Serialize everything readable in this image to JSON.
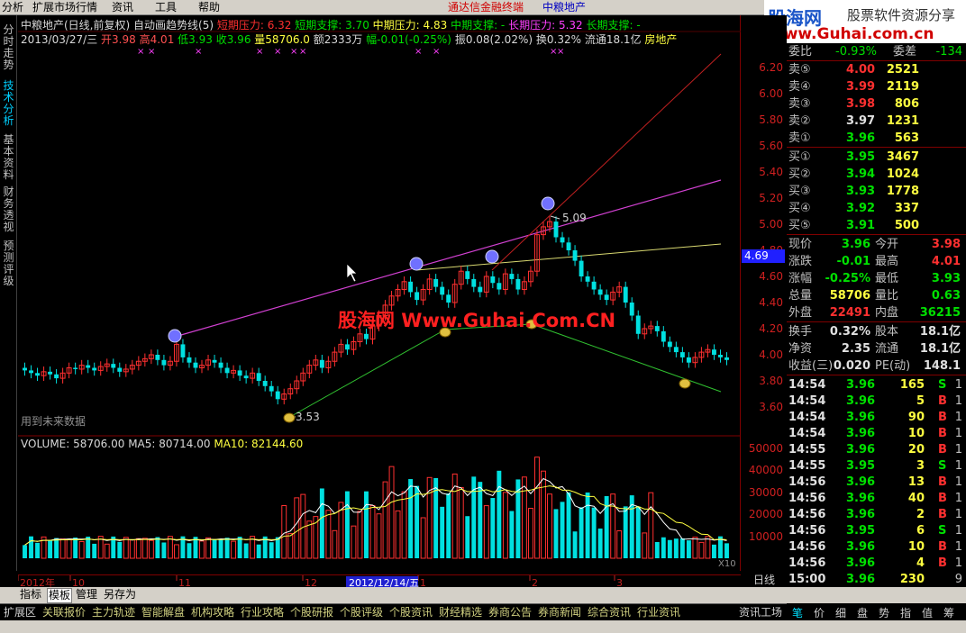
{
  "menubar": {
    "items": [
      "分析",
      "扩展市场行情",
      "资讯",
      "工具",
      "帮助"
    ],
    "center_red": "通达信金融终端",
    "center_blue": "中粮地产"
  },
  "logo": {
    "brand": "股海网",
    "tagline": "股票软件资源分享",
    "url": "www.Guhai.com.cn"
  },
  "sidetabs": [
    {
      "label": "分时走势",
      "active": false
    },
    {
      "label": "技术分析",
      "active": true
    },
    {
      "label": "基本资料",
      "active": false
    },
    {
      "label": "财务透视",
      "active": false
    },
    {
      "label": "预测评级",
      "active": false
    }
  ],
  "header": {
    "title": "中粮地产(日线,前复权)",
    "indicator": "自动画趋势线(5)",
    "short_pressure": "短期压力: 6.32",
    "short_support": "短期支撑: 3.70",
    "mid_pressure": "中期压力: 4.83",
    "mid_support": "中期支撑: -",
    "long_pressure": "长期压力: 5.32",
    "long_support": "长期支撑: -",
    "date": "2013/03/27/三",
    "open": "开3.98",
    "high": "高4.01",
    "low": "低3.93",
    "close": "收3.96",
    "volume": "量58706.0",
    "amount": "额2333万",
    "change": "幅-0.01(-0.25%)",
    "amplitude": "振0.08(2.02%)",
    "turnover": "换0.32%",
    "float": "流通18.1亿",
    "sector": "房地产"
  },
  "annotations": {
    "peak": "5.09",
    "trough": "3.53",
    "future_data": "用到未来数据",
    "watermark": "股海网 Www.Guhai.Com.CN"
  },
  "volume_header": {
    "volume": "VOLUME: 58706.00",
    "ma5": "MA5: 80714.00",
    "ma10": "MA10: 82144.60"
  },
  "price_axis": [
    "6.20",
    "6.00",
    "5.80",
    "5.60",
    "5.40",
    "5.20",
    "5.00",
    "4.80",
    "4.60",
    "4.40",
    "4.20",
    "4.00",
    "3.80",
    "3.60"
  ],
  "volume_axis": [
    "50000",
    "40000",
    "30000",
    "20000",
    "10000"
  ],
  "volume_unit": "X10",
  "current_price_tag": "4.69",
  "date_axis": {
    "labels": [
      "2012年",
      "10",
      "11",
      "12",
      "1",
      "2",
      "3"
    ],
    "cursor_date": "2012/12/14/五"
  },
  "quote": {
    "weibi_label": "委比",
    "weibi_value": "-0.93%",
    "weicha_label": "委差",
    "weicha_value": "-134",
    "asks": [
      {
        "label": "卖⑤",
        "price": "4.00",
        "vol": "2521",
        "color": "#ff3030"
      },
      {
        "label": "卖④",
        "price": "3.99",
        "vol": "2119",
        "color": "#ff3030"
      },
      {
        "label": "卖③",
        "price": "3.98",
        "vol": "806",
        "color": "#ff3030"
      },
      {
        "label": "卖②",
        "price": "3.97",
        "vol": "1231",
        "color": "#e0e0e0"
      },
      {
        "label": "卖①",
        "price": "3.96",
        "vol": "563",
        "color": "#00e000"
      }
    ],
    "bids": [
      {
        "label": "买①",
        "price": "3.95",
        "vol": "3467",
        "color": "#00e000"
      },
      {
        "label": "买②",
        "price": "3.94",
        "vol": "1024",
        "color": "#00e000"
      },
      {
        "label": "买③",
        "price": "3.93",
        "vol": "1778",
        "color": "#00e000"
      },
      {
        "label": "买④",
        "price": "3.92",
        "vol": "337",
        "color": "#00e000"
      },
      {
        "label": "买⑤",
        "price": "3.91",
        "vol": "500",
        "color": "#00e000"
      }
    ],
    "stats": [
      {
        "l1": "现价",
        "v1": "3.96",
        "c1": "#00e000",
        "l2": "今开",
        "v2": "3.98",
        "c2": "#ff3030"
      },
      {
        "l1": "涨跌",
        "v1": "-0.01",
        "c1": "#00e000",
        "l2": "最高",
        "v2": "4.01",
        "c2": "#ff3030"
      },
      {
        "l1": "涨幅",
        "v1": "-0.25%",
        "c1": "#00e000",
        "l2": "最低",
        "v2": "3.93",
        "c2": "#00e000"
      },
      {
        "l1": "总量",
        "v1": "58706",
        "c1": "#ffff40",
        "l2": "量比",
        "v2": "0.63",
        "c2": "#00e000"
      },
      {
        "l1": "外盘",
        "v1": "22491",
        "c1": "#ff3030",
        "l2": "内盘",
        "v2": "36215",
        "c2": "#00e000"
      }
    ],
    "stats2": [
      {
        "l1": "换手",
        "v1": "0.32%",
        "l2": "股本",
        "v2": "18.1亿"
      },
      {
        "l1": "净资",
        "v1": "2.35",
        "l2": "流通",
        "v2": "18.1亿"
      },
      {
        "l1": "收益(三)",
        "v1": "0.020",
        "l2": "PE(动)",
        "v2": "148.1"
      }
    ],
    "ticks": [
      {
        "time": "14:54",
        "price": "3.96",
        "vol": "165",
        "side": "S",
        "n": "1"
      },
      {
        "time": "14:54",
        "price": "3.96",
        "vol": "5",
        "side": "B",
        "n": "1"
      },
      {
        "time": "14:54",
        "price": "3.96",
        "vol": "90",
        "side": "B",
        "n": "1"
      },
      {
        "time": "14:54",
        "price": "3.96",
        "vol": "10",
        "side": "B",
        "n": "1"
      },
      {
        "time": "14:55",
        "price": "3.96",
        "vol": "20",
        "side": "B",
        "n": "1"
      },
      {
        "time": "14:55",
        "price": "3.95",
        "vol": "3",
        "side": "S",
        "n": "1"
      },
      {
        "time": "14:56",
        "price": "3.96",
        "vol": "13",
        "side": "B",
        "n": "1"
      },
      {
        "time": "14:56",
        "price": "3.96",
        "vol": "40",
        "side": "B",
        "n": "1"
      },
      {
        "time": "14:56",
        "price": "3.96",
        "vol": "2",
        "side": "B",
        "n": "1"
      },
      {
        "time": "14:56",
        "price": "3.95",
        "vol": "6",
        "side": "S",
        "n": "1"
      },
      {
        "time": "14:56",
        "price": "3.96",
        "vol": "10",
        "side": "B",
        "n": "1"
      },
      {
        "time": "14:56",
        "price": "3.96",
        "vol": "4",
        "side": "B",
        "n": "1"
      },
      {
        "time": "15:00",
        "price": "3.96",
        "vol": "230",
        "side": "",
        "n": "9"
      }
    ]
  },
  "period_label": "日线",
  "zoom_controls": "+ - ○",
  "bottom_tabs": [
    "指标",
    "模板",
    "管理",
    "另存为"
  ],
  "statusbar": [
    "扩展区",
    "关联报价",
    "主力轨迹",
    "智能解盘",
    "机构攻略",
    "行业攻略",
    "个股研报",
    "个股评级",
    "个股资讯",
    "财经精选",
    "券商公告",
    "券商新闻",
    "综合资讯",
    "行业资讯",
    "资讯工场"
  ],
  "right_status": [
    "笔",
    "价",
    "细",
    "盘",
    "势",
    "指",
    "值",
    "筹"
  ],
  "colors": {
    "up": "#ff3030",
    "down": "#00e0e0",
    "ma5": "#ffffff",
    "ma10": "#ffff40"
  }
}
